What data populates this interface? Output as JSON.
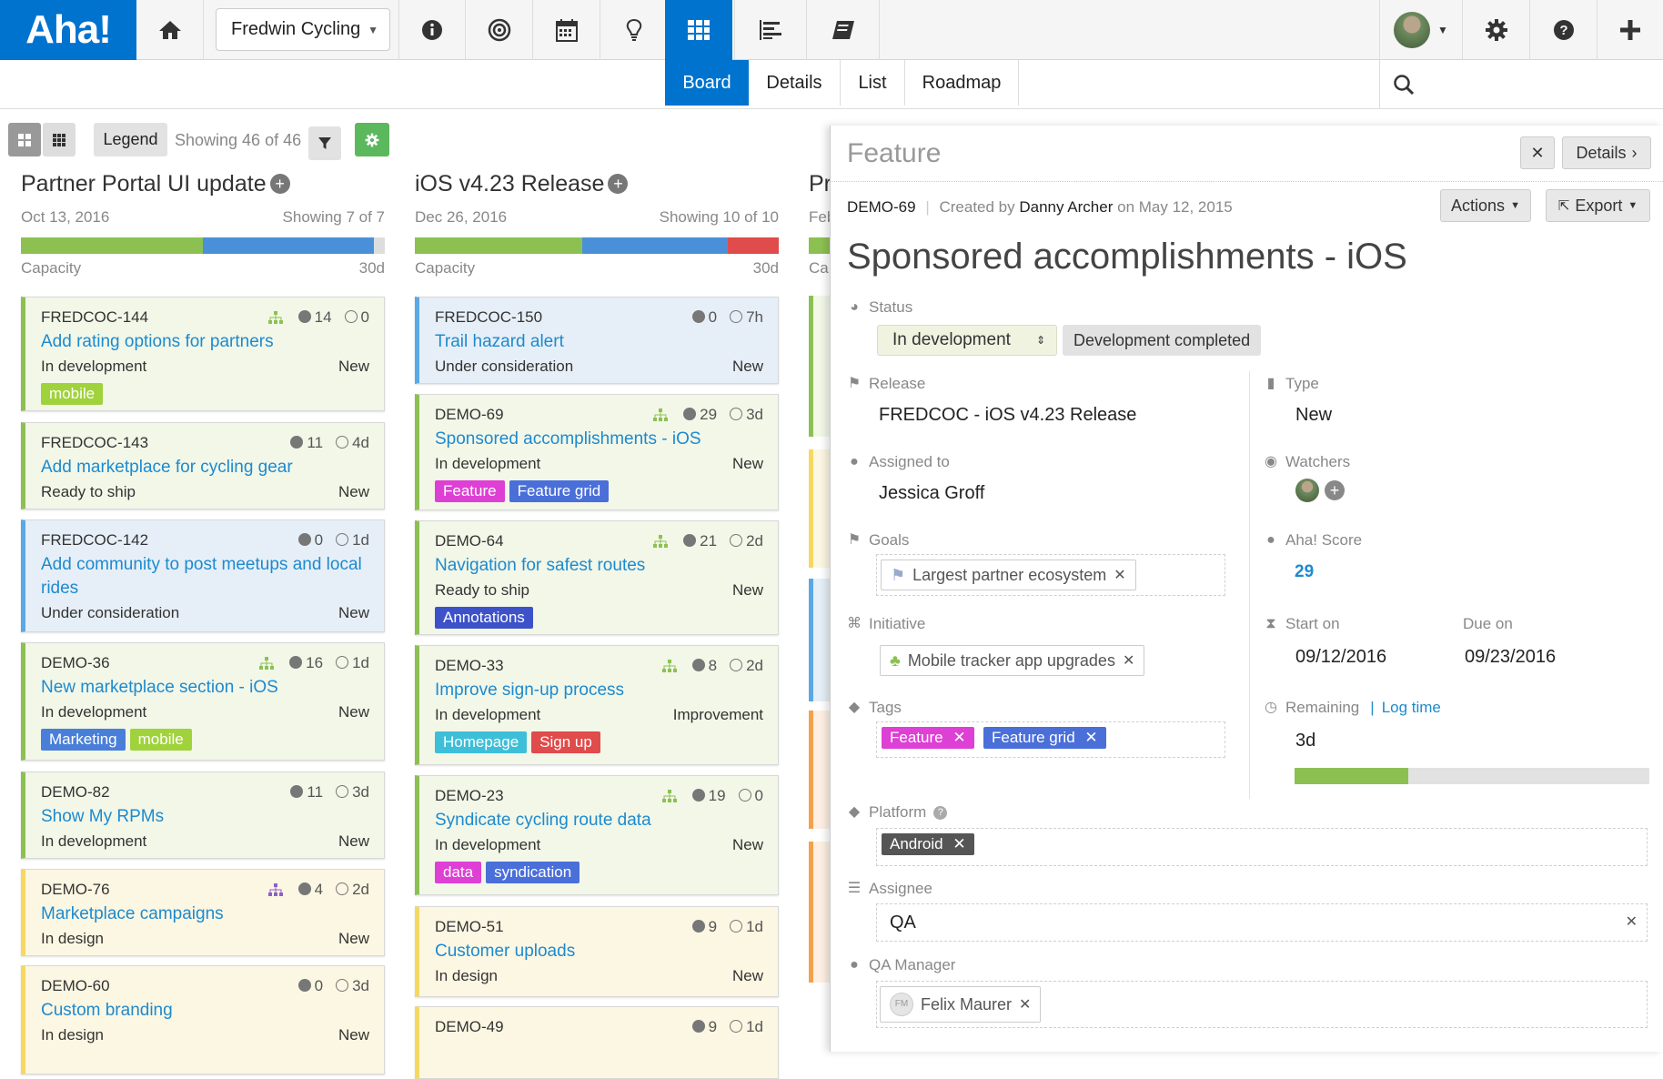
{
  "app": {
    "logo": "Aha!",
    "workspace": "Fredwin Cycling"
  },
  "subtabs": [
    "Board",
    "Details",
    "List",
    "Roadmap"
  ],
  "toolbar": {
    "legend": "Legend",
    "showing": "Showing 46 of 46"
  },
  "colors": {
    "brand": "#0073cf",
    "green": "#8cc152",
    "blue": "#4a90d9",
    "red": "#e04b4b",
    "yellow": "#f6d860",
    "lightblue": "#5aa9e6",
    "orange": "#f5a04b"
  },
  "columns": [
    {
      "title": "Partner Portal UI update",
      "date": "Oct 13, 2016",
      "showing": "Showing 7 of 7",
      "capacity": "Capacity",
      "days": "30d"
    },
    {
      "title": "iOS v4.23 Release",
      "date": "Dec 26, 2016",
      "showing": "Showing 10 of 10",
      "capacity": "Capacity",
      "days": "30d"
    },
    {
      "title": "Pr",
      "date": "Feb",
      "capacity": "Ca"
    }
  ],
  "cards1": [
    {
      "ref": "FREDCOC-144",
      "c": "14",
      "t": "0",
      "title": "Add rating options for partners",
      "status": "In development",
      "type": "New",
      "tags": [
        "mobile"
      ]
    },
    {
      "ref": "FREDCOC-143",
      "c": "11",
      "t": "4d",
      "title": "Add marketplace for cycling gear",
      "status": "Ready to ship",
      "type": "New",
      "tags": []
    },
    {
      "ref": "FREDCOC-142",
      "c": "0",
      "t": "1d",
      "title": "Add community to post meetups and local rides",
      "status": "Under consideration",
      "type": "New",
      "tags": []
    },
    {
      "ref": "DEMO-36",
      "c": "16",
      "t": "1d",
      "title": "New marketplace section - iOS",
      "status": "In development",
      "type": "New",
      "tags": [
        "Marketing",
        "mobile"
      ]
    },
    {
      "ref": "DEMO-82",
      "c": "11",
      "t": "3d",
      "title": "Show My RPMs",
      "status": "In development",
      "type": "New",
      "tags": []
    },
    {
      "ref": "DEMO-76",
      "c": "4",
      "t": "2d",
      "title": "Marketplace campaigns",
      "status": "In design",
      "type": "New",
      "tags": []
    },
    {
      "ref": "DEMO-60",
      "c": "0",
      "t": "3d",
      "title": "Custom branding",
      "status": "In design",
      "type": "New",
      "tags": []
    }
  ],
  "cards2": [
    {
      "ref": "FREDCOC-150",
      "c": "0",
      "t": "7h",
      "title": "Trail hazard alert",
      "status": "Under consideration",
      "type": "New",
      "tags": []
    },
    {
      "ref": "DEMO-69",
      "c": "29",
      "t": "3d",
      "title": "Sponsored accomplishments - iOS",
      "status": "In development",
      "type": "New",
      "tags": [
        "Feature",
        "Feature grid"
      ]
    },
    {
      "ref": "DEMO-64",
      "c": "21",
      "t": "2d",
      "title": "Navigation for safest routes",
      "status": "Ready to ship",
      "type": "New",
      "tags": [
        "Annotations"
      ]
    },
    {
      "ref": "DEMO-33",
      "c": "8",
      "t": "2d",
      "title": "Improve sign-up process",
      "status": "In development",
      "type": "Improvement",
      "tags": [
        "Homepage",
        "Sign up"
      ]
    },
    {
      "ref": "DEMO-23",
      "c": "19",
      "t": "0",
      "title": "Syndicate cycling route data",
      "status": "In development",
      "type": "New",
      "tags": [
        "data",
        "syndication"
      ]
    },
    {
      "ref": "DEMO-51",
      "c": "9",
      "t": "1d",
      "title": "Customer uploads",
      "status": "In design",
      "type": "New",
      "tags": []
    },
    {
      "ref": "DEMO-49",
      "c": "9",
      "t": "1d",
      "title": "",
      "status": "",
      "type": "",
      "tags": []
    }
  ],
  "panel": {
    "heading": "Feature",
    "details_btn": "Details",
    "ref": "DEMO-69",
    "created_by": "Created by",
    "author": "Danny Archer",
    "on": "on May 12, 2015",
    "actions": "Actions",
    "export": "Export",
    "title": "Sponsored accomplishments - iOS",
    "status_label": "Status",
    "status": "In development",
    "status_next": "Development completed",
    "release_label": "Release",
    "release": "FREDCOC - iOS v4.23 Release",
    "type_label": "Type",
    "type": "New",
    "assigned_label": "Assigned to",
    "assigned": "Jessica Groff",
    "watchers_label": "Watchers",
    "goals_label": "Goals",
    "goal": "Largest partner ecosystem",
    "score_label": "Aha! Score",
    "score": "29",
    "initiative_label": "Initiative",
    "initiative": "Mobile tracker app upgrades",
    "start_label": "Start on",
    "start": "09/12/2016",
    "due_label": "Due on",
    "due": "09/23/2016",
    "tags_label": "Tags",
    "tag1": "Feature",
    "tag2": "Feature grid",
    "remaining_label": "Remaining",
    "logtime": "Log time",
    "remaining": "3d",
    "remaining_progress": 0.32,
    "platform_label": "Platform",
    "platform": "Android",
    "assignee_label": "Assignee",
    "assignee": "QA",
    "qa_label": "QA Manager",
    "qa_initials": "FM",
    "qa": "Felix Maurer"
  }
}
